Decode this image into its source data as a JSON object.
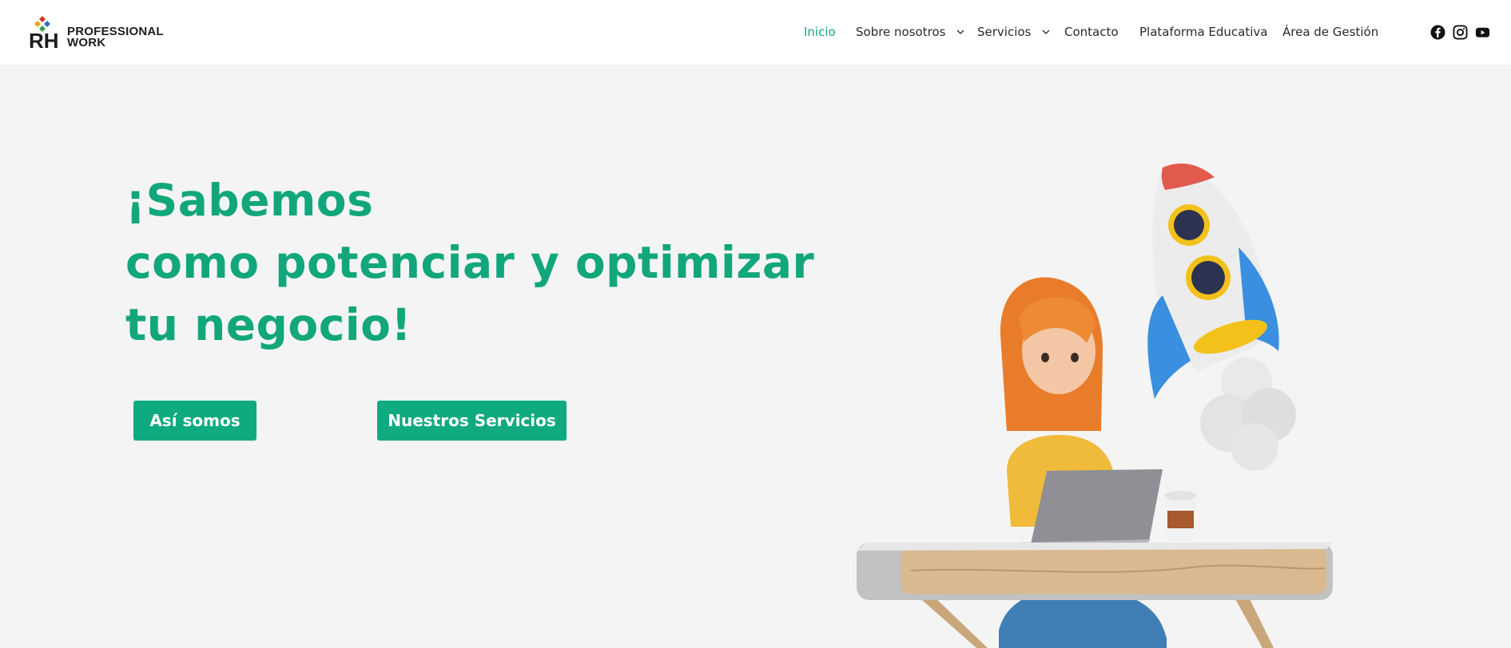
{
  "header": {
    "logo": {
      "mark": "RH",
      "line1": "PROFESSIONAL",
      "line2": "WORK"
    },
    "nav": [
      {
        "label": "Inicio",
        "active": true,
        "dropdown": false
      },
      {
        "label": "Sobre nosotros",
        "active": false,
        "dropdown": true
      },
      {
        "label": "Servicios",
        "active": false,
        "dropdown": true
      },
      {
        "label": "Contacto",
        "active": false,
        "dropdown": false
      },
      {
        "label": "Plataforma Educativa",
        "active": false,
        "dropdown": false
      },
      {
        "label": "Área de Gestión",
        "active": false,
        "dropdown": false
      }
    ],
    "social": [
      "facebook-icon",
      "instagram-icon",
      "youtube-icon"
    ]
  },
  "hero": {
    "headline": [
      "¡Sabemos",
      "como potenciar y optimizar",
      "tu negocio!"
    ],
    "buttons": {
      "about": "Así somos",
      "services": "Nuestros Servicios"
    }
  },
  "colors": {
    "accent": "#12a67b",
    "button": "#0faa7f",
    "background": "#f4f4f4",
    "text": "#2a2a2a"
  }
}
